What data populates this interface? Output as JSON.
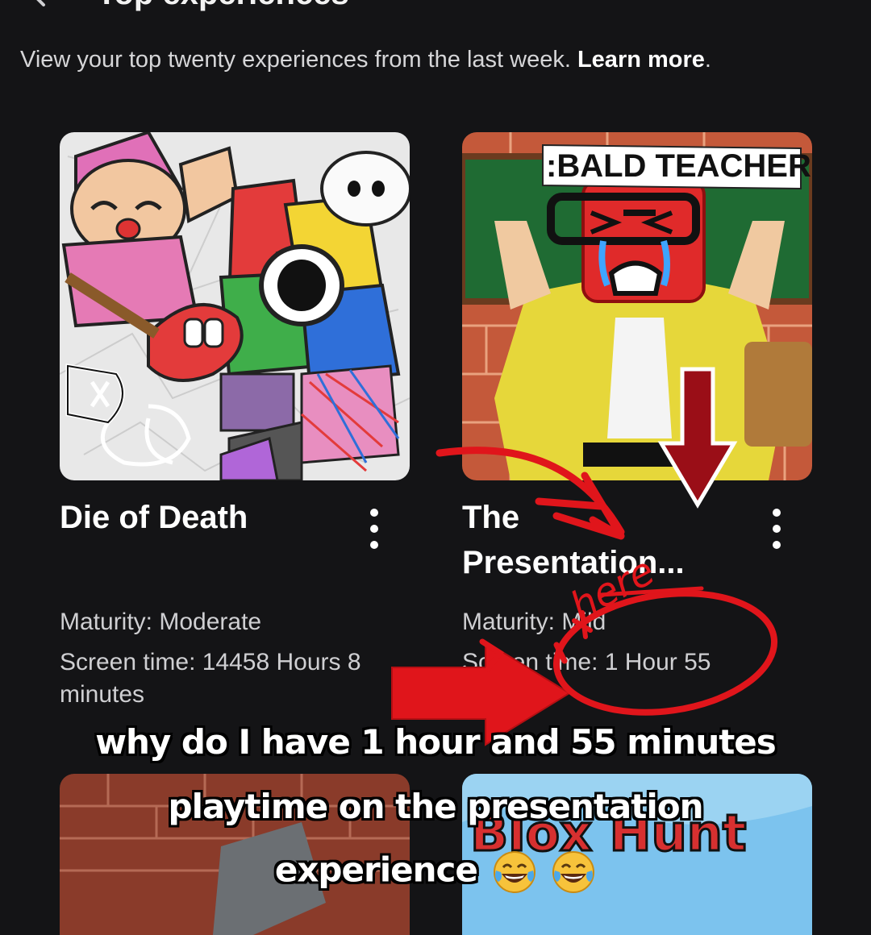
{
  "header": {
    "title": "Top experiences",
    "subtitle_text": "View your top twenty experiences from the last week. ",
    "learn_more": "Learn more",
    "subtitle_end": "."
  },
  "cards": [
    {
      "title": "Die of Death",
      "maturity": "Maturity: Moderate",
      "screen_time": "Screen time: 14458 Hours 8 minutes",
      "thumbnail_logo": "DxD",
      "thumbnail_colors": [
        "#ececec",
        "#e25aa6",
        "#e33b3b",
        "#f3d534",
        "#2f6fd9",
        "#3fae4a"
      ]
    },
    {
      "title": "The Presentation...",
      "maturity": "Maturity: Mild",
      "screen_time": "Screen time: 1 Hour 55",
      "thumbnail_banner": ":BALD TEACHER",
      "thumbnail_colors": [
        "#c85a34",
        "#2a7a3a",
        "#e7d83a",
        "#dd2222"
      ]
    },
    {
      "title": "",
      "thumbnail_colors": [
        "#8a3b2a",
        "#555555"
      ]
    },
    {
      "title": "",
      "thumbnail_text": "Blox Hunt",
      "thumbnail_colors": [
        "#7cc3ee",
        "#2a55c8",
        "#d73030"
      ]
    }
  ],
  "annotations": {
    "scribble": "here",
    "caption_lines": [
      "why do I have 1 hour and 55 minutes",
      "playtime on the presentation",
      "experience"
    ],
    "emoji": "face-with-tears-of-joy",
    "accent_red": "#e0151b",
    "arrow_dark_red": "#9a0e17"
  }
}
